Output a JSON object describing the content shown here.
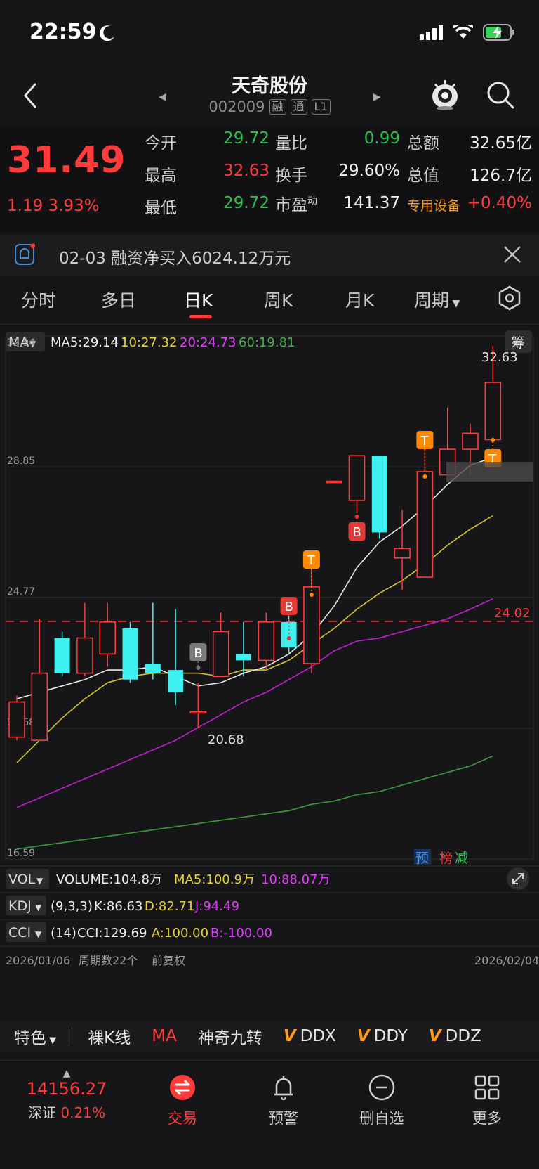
{
  "status": {
    "time": "22:59"
  },
  "nav": {
    "stock_name": "天奇股份",
    "stock_code": "002009",
    "tags": [
      "融",
      "通",
      "L1"
    ]
  },
  "quote": {
    "last_price": "31.49",
    "change": "1.19 3.93%",
    "rows": [
      {
        "l1": "今开",
        "v1": "29.72",
        "l2": "量比",
        "v2": "0.99",
        "l3": "总额",
        "v3": "32.65亿"
      },
      {
        "l1": "最高",
        "v1": "32.63",
        "l2": "换手",
        "v2": "29.60%",
        "l3": "总值",
        "v3": "126.7亿"
      },
      {
        "l1": "最低",
        "v1": "29.72",
        "l2": "市盈",
        "l2_sup": "动",
        "v2": "141.37",
        "l3": "专用设备",
        "v3": "+0.40%"
      }
    ]
  },
  "news": {
    "text": "02-03 融资净买入6024.12万元"
  },
  "tabs": {
    "items": [
      "分时",
      "多日",
      "日K",
      "周K",
      "月K",
      "周期"
    ],
    "active": "日K"
  },
  "chart": {
    "ma_label": "MA",
    "ma5": "MA5:29.14",
    "ma10": "10:27.32",
    "ma20": "20:24.73",
    "ma60": "60:19.81",
    "chip_btn": "筹",
    "y_labels": [
      "32.94",
      "28.85",
      "24.77",
      "20.68",
      "16.59"
    ],
    "high_label": "32.63",
    "low_label": "20.68",
    "ref_line_label": "24.02",
    "badges": [
      "预",
      "榜",
      "减"
    ],
    "vol_label": "VOL",
    "vol_text": "VOLUME:104.8万",
    "vol_ma5": "MA5:100.9万",
    "vol_ma10": "10:88.07万",
    "kdj_label": "KDJ",
    "kdj_params": "(9,3,3)",
    "kdj_k": "K:86.63",
    "kdj_d": "D:82.71",
    "kdj_j": "J:94.49",
    "cci_label": "CCI",
    "cci_params": "(14)",
    "cci_v": "CCI:129.69",
    "cci_a": "A:100.00",
    "cci_b": "B:-100.00",
    "date_start": "2026/01/06",
    "period_count": "周期数22个",
    "adjust": "前复权",
    "date_end": "2026/02/04",
    "signal_b": "B",
    "signal_t": "T"
  },
  "chart_data": {
    "type": "candlestick",
    "ylim": [
      16.59,
      32.94
    ],
    "candles": [
      {
        "o": 20.4,
        "c": 21.5,
        "h": 21.7,
        "l": 20.3
      },
      {
        "o": 20.3,
        "c": 22.4,
        "h": 24.1,
        "l": 20.3
      },
      {
        "o": 23.5,
        "c": 22.4,
        "h": 23.7,
        "l": 22.3
      },
      {
        "o": 22.4,
        "c": 23.5,
        "h": 24.6,
        "l": 22.3
      },
      {
        "o": 23.0,
        "c": 24.0,
        "h": 24.6,
        "l": 22.6
      },
      {
        "o": 23.8,
        "c": 22.2,
        "h": 24.0,
        "l": 22.1
      },
      {
        "o": 22.7,
        "c": 22.4,
        "h": 24.6,
        "l": 22.2
      },
      {
        "o": 22.5,
        "c": 21.8,
        "h": 24.4,
        "l": 21.4
      },
      {
        "o": 21.2,
        "c": 21.2,
        "h": 22.1,
        "l": 20.68
      },
      {
        "o": 22.3,
        "c": 23.7,
        "h": 24.3,
        "l": 22.3
      },
      {
        "o": 23.0,
        "c": 22.8,
        "h": 24.0,
        "l": 22.3
      },
      {
        "o": 22.8,
        "c": 24.0,
        "h": 24.3,
        "l": 22.5
      },
      {
        "o": 24.0,
        "c": 23.2,
        "h": 24.3,
        "l": 23.0
      },
      {
        "o": 22.7,
        "c": 25.1,
        "h": 25.7,
        "l": 22.4
      },
      {
        "o": 28.4,
        "c": 28.4,
        "h": 28.4,
        "l": 28.4
      },
      {
        "o": 27.8,
        "c": 29.2,
        "h": 29.2,
        "l": 27.4
      },
      {
        "o": 29.2,
        "c": 26.8,
        "h": 29.2,
        "l": 26.6
      },
      {
        "o": 26.0,
        "c": 26.3,
        "h": 27.5,
        "l": 25.0
      },
      {
        "o": 25.4,
        "c": 28.7,
        "h": 29.7,
        "l": 25.4
      },
      {
        "o": 28.6,
        "c": 29.4,
        "h": 30.7,
        "l": 28.6
      },
      {
        "o": 29.4,
        "c": 29.9,
        "h": 30.2,
        "l": 28.6
      },
      {
        "o": 29.7,
        "c": 31.49,
        "h": 32.63,
        "l": 29.72
      }
    ],
    "ma5": [
      21.6,
      21.8,
      22.0,
      22.2,
      22.5,
      22.5,
      22.6,
      22.3,
      22.0,
      22.1,
      22.4,
      22.6,
      23.0,
      23.6,
      24.5,
      25.7,
      26.5,
      27.0,
      27.6,
      28.3,
      28.9,
      29.14
    ],
    "ma10": [
      19.6,
      20.3,
      21.0,
      21.6,
      22.1,
      22.3,
      22.4,
      22.4,
      22.4,
      22.3,
      22.5,
      22.5,
      22.8,
      23.3,
      23.8,
      24.4,
      24.9,
      25.3,
      25.8,
      26.4,
      26.9,
      27.32
    ],
    "ma20": [
      18.2,
      18.5,
      18.8,
      19.1,
      19.4,
      19.7,
      20.0,
      20.3,
      20.7,
      21.1,
      21.5,
      21.8,
      22.2,
      22.6,
      23.1,
      23.4,
      23.5,
      23.7,
      23.9,
      24.1,
      24.4,
      24.73
    ],
    "ma60": [
      16.9,
      17.0,
      17.1,
      17.2,
      17.3,
      17.4,
      17.5,
      17.6,
      17.7,
      17.8,
      17.9,
      18.0,
      18.1,
      18.3,
      18.4,
      18.6,
      18.7,
      18.9,
      19.1,
      19.3,
      19.5,
      19.81
    ],
    "ref_line": 24.02
  },
  "indicator_bar": {
    "items": [
      "特色",
      "裸K线",
      "MA",
      "神奇九转",
      "DDX",
      "DDY",
      "DDZ"
    ]
  },
  "tabbar": {
    "index_value": "14156.27",
    "index_name": "深证",
    "index_change": "0.21%",
    "items": [
      "交易",
      "预警",
      "删自选",
      "更多"
    ]
  }
}
